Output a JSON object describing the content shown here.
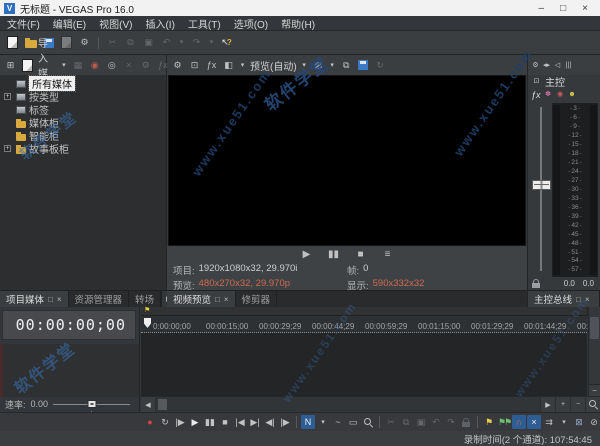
{
  "window": {
    "logo_letter": "V",
    "title": "无标题 - VEGAS Pro 16.0",
    "minimize": "–",
    "maximize": "□",
    "close": "×"
  },
  "menu": {
    "items": [
      "文件(F)",
      "编辑(E)",
      "视图(V)",
      "插入(I)",
      "工具(T)",
      "选项(O)",
      "帮助(H)"
    ]
  },
  "icons": {
    "gear": "⚙",
    "grid": "⊞",
    "dropdown": "▼",
    "caret": "▾",
    "cut": "✂",
    "copy": "⧉",
    "paste": "▣",
    "undo": "↶",
    "redo": "↷",
    "help_arrow": "↖",
    "help_q": "?",
    "preview_dim": "▦",
    "camera": "◉",
    "extract": "◎",
    "remove": "×",
    "fx": "ƒx",
    "monitor": "⊡",
    "split": "◧",
    "safe_grid": "▦",
    "loop2": "↻",
    "play": "▶",
    "pause": "▮▮",
    "stop": "■",
    "menu": "≡",
    "mix": "◂▸",
    "dim": "◁",
    "meters": "|||",
    "flower": "✽",
    "dot": "◉",
    "smiley": "☻",
    "record": "●",
    "loop": "↻",
    "play_start": "|▶",
    "go_start": "|◀",
    "go_end": "▶|",
    "prev_frame": "◀|",
    "next_frame": "|▶",
    "edit_tool": "N",
    "envelope": "~",
    "selection": "▭",
    "marker": "⚑",
    "region": "⚑⚑",
    "snap": "∩",
    "crossfade": "×",
    "ripple": "⇉",
    "lock_env": "⊠",
    "ignore_group": "⊘",
    "arrow_left": "◀",
    "arrow_right": "▶",
    "plus": "+",
    "minus": "−",
    "flag": "⚑",
    "box": "□",
    "close": "×"
  },
  "media_panel": {
    "import_label": "导入媒体...",
    "tree": [
      {
        "label": "所有媒体"
      },
      {
        "label": "按类型"
      },
      {
        "label": "标签"
      },
      {
        "label": "媒体柜"
      },
      {
        "label": "智能柜"
      },
      {
        "label": "故事板柜"
      }
    ],
    "tabs": [
      "项目媒体",
      "资源管理器",
      "转场"
    ]
  },
  "preview_panel": {
    "preview_mode": "预览(自动)",
    "status": {
      "project_label": "项目:",
      "project_value": "1920x1080x32, 29.970i",
      "preview_label": "预览:",
      "preview_value": "480x270x32, 29.970p",
      "frame_label": "帧:",
      "frame_value": "0",
      "display_label": "显示:",
      "display_value": "590x332x32"
    },
    "tabs": [
      "视频预览",
      "修剪器"
    ]
  },
  "master_bus": {
    "label": "主控",
    "scale": [
      "3",
      "6",
      "9",
      "12",
      "15",
      "18",
      "21",
      "24",
      "27",
      "30",
      "33",
      "36",
      "39",
      "42",
      "45",
      "48",
      "51",
      "54",
      "57"
    ],
    "value_left": "0.0",
    "value_right": "0.0",
    "tab": "主控总线"
  },
  "timeline": {
    "timecode": "00:00:00;00",
    "ruler": [
      "0:00:00;00",
      "00:00:15;00",
      "00:00:29;29",
      "00:00:44;29",
      "00:00:59;29",
      "00:01:15;00",
      "00:01:29;29",
      "00:01:44;29",
      "00:0"
    ],
    "rate_label": "速率:",
    "rate_value": "0.00"
  },
  "status_bar": {
    "record_time": "录制时间(2 个通道): 107:54:45"
  },
  "watermark": {
    "site": "软件学堂",
    "url": "www.xue51.com"
  },
  "colors": {
    "accent_blue": "#2e5d94",
    "warn_red": "#cd6a50",
    "marker_yellow": "#e3cf4a",
    "region_green": "#6fc26f",
    "record_red": "#d04040",
    "logo_blue": "#2f6fc1"
  }
}
